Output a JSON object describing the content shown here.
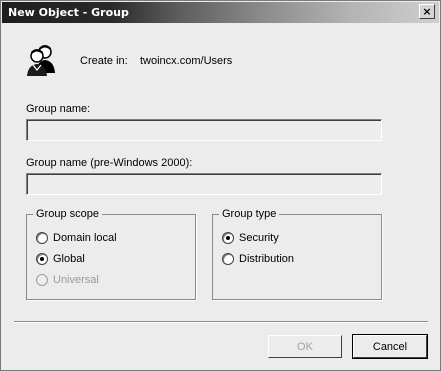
{
  "window": {
    "title": "New Object - Group",
    "close_glyph": "×"
  },
  "header": {
    "icon": "group-users-icon",
    "create_in_label": "Create in:",
    "create_in_value": "twoincx.com/Users"
  },
  "fields": {
    "group_name_label": "Group name:",
    "group_name_value": "",
    "group_name_pre2000_label": "Group name (pre-Windows 2000):",
    "group_name_pre2000_value": ""
  },
  "group_scope": {
    "legend": "Group scope",
    "options": [
      {
        "label": "Domain local",
        "selected": false,
        "enabled": true
      },
      {
        "label": "Global",
        "selected": true,
        "enabled": true
      },
      {
        "label": "Universal",
        "selected": false,
        "enabled": false
      }
    ]
  },
  "group_type": {
    "legend": "Group type",
    "options": [
      {
        "label": "Security",
        "selected": true,
        "enabled": true
      },
      {
        "label": "Distribution",
        "selected": false,
        "enabled": true
      }
    ]
  },
  "buttons": {
    "ok_label": "OK",
    "cancel_label": "Cancel"
  }
}
